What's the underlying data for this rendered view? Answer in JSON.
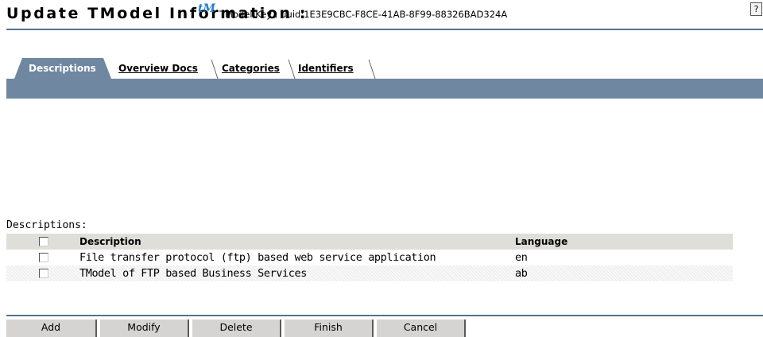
{
  "header": {
    "title": "Update TModel Information :",
    "tm_icon_text": "tM",
    "tmodel_key": "TModel Key : uuid:1E3E9CBC-F8CE-41AB-8F99-88326BAD324A",
    "help_icon_text": "?"
  },
  "tabs": [
    {
      "label": "Descriptions",
      "active": true
    },
    {
      "label": "Overview Docs",
      "active": false
    },
    {
      "label": "Categories",
      "active": false
    },
    {
      "label": "Identifiers",
      "active": false
    }
  ],
  "section_label": "Descriptions:",
  "table": {
    "columns": [
      "Description",
      "Language"
    ],
    "rows": [
      {
        "description": "File transfer protocol (ftp) based web service application",
        "language": "en"
      },
      {
        "description": "TModel of FTP based Business Services",
        "language": "ab"
      }
    ]
  },
  "buttons": {
    "add": "Add",
    "modify": "Modify",
    "delete": "Delete",
    "finish": "Finish",
    "cancel": "Cancel"
  },
  "colors": {
    "tab_bar": "#6f87a0",
    "rule": "#55728c",
    "tm_icon": "#1f7fd6",
    "table_header": "#e0ded8"
  }
}
